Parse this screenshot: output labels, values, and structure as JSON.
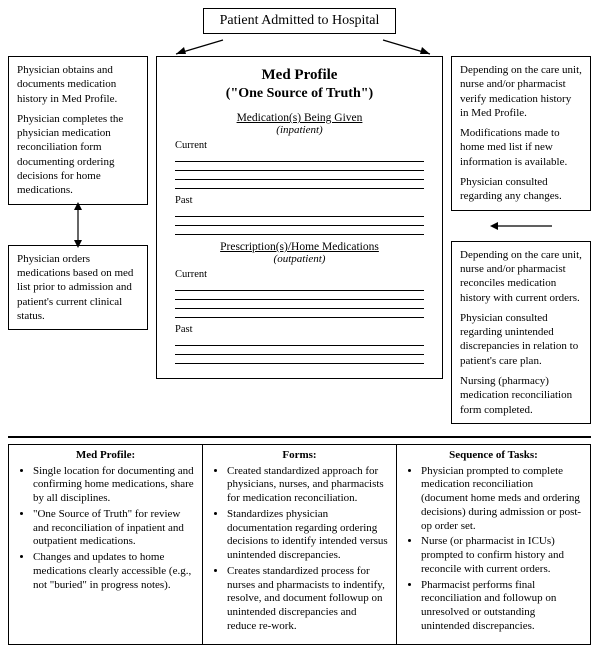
{
  "title": "Patient Admitted to Hospital",
  "center": {
    "title": "Med Profile",
    "subtitle": "(\"One Source of Truth\")",
    "sect1_head": "Medication(s) Being Given",
    "sect1_sub": "(inpatient)",
    "sect2_head": "Prescription(s)/Home Medications",
    "sect2_sub": "(outpatient)",
    "label_current": "Current",
    "label_past": "Past"
  },
  "left_box1": {
    "p1": "Physician obtains and documents medication history in Med Profile.",
    "p2": "Physician completes the physician medication reconciliation form documenting ordering decisions for home medications."
  },
  "left_box2": {
    "p1": "Physician orders medications based on med list prior to admission and patient's current clinical status."
  },
  "right_box1": {
    "p1": "Depending on the care unit, nurse and/or pharmacist verify medication history in Med Profile.",
    "p2": "Modifications made to home med list if new information is available.",
    "p3": "Physician consulted regarding any changes."
  },
  "right_box2": {
    "p1": "Depending on the care unit, nurse and/or pharmacist reconciles medication history with current orders.",
    "p2": "Physician consulted regarding unintended discrepancies in relation to patient's care plan.",
    "p3": "Nursing (pharmacy) medication reconciliation form completed."
  },
  "bottom": {
    "col1_title": "Med Profile:",
    "col1_items": [
      "Single location for documenting and confirming home medications, share by all disciplines.",
      "\"One Source of Truth\" for review and reconciliation of inpatient and outpatient medications.",
      "Changes and updates to home medications clearly accessible (e.g., not \"buried\" in progress notes)."
    ],
    "col2_title": "Forms:",
    "col2_items": [
      "Created standardized approach for physicians, nurses, and pharmacists for medication reconciliation.",
      "Standardizes physician documentation regarding ordering decisions to identify intended versus unintended discrepancies.",
      "Creates standardized process for nurses and pharmacists to indentify, resolve, and document followup on unintended discrepancies and reduce re-work."
    ],
    "col3_title": "Sequence of Tasks:",
    "col3_items": [
      "Physician prompted to complete medication reconciliation (document home meds and ordering decisions) during admission or post-op order set.",
      "Nurse (or pharmacist in ICUs) prompted to confirm history and reconcile with current orders.",
      "Pharmacist performs final reconciliation and followup on unresolved or outstanding unintended discrepancies."
    ]
  }
}
